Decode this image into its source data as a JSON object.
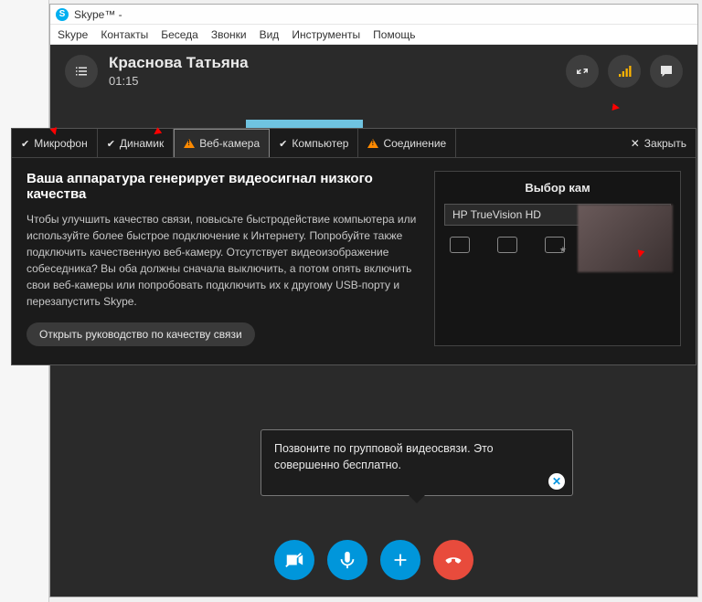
{
  "titlebar": {
    "app": "Skype™ -"
  },
  "menu": {
    "skype": "Skype",
    "contacts": "Контакты",
    "conversation": "Беседа",
    "calls": "Звонки",
    "view": "Вид",
    "tools": "Инструменты",
    "help": "Помощь"
  },
  "call": {
    "contact_name": "Краснова Татьяна",
    "duration": "01:15"
  },
  "diag": {
    "tabs": {
      "mic": "Микрофон",
      "speaker": "Динамик",
      "webcam": "Веб-камера",
      "computer": "Компьютер",
      "connection": "Соединение",
      "close": "Закрыть"
    },
    "title": "Ваша аппаратура генерирует видеосигнал низкого качества",
    "text": "Чтобы улучшить качество связи, повысьте быстродействие компьютера или используйте более быстрое подключение к Интернету. Попробуйте также подключить качественную веб-камеру. Отсутствует видеоизображение собеседника? Вы оба должны сначала выключить, а потом опять включить свои веб-камеры или попробовать подключить их к другому USB-порту и перезапустить Skype.",
    "guide_btn": "Открыть руководство по качеству связи",
    "camera": {
      "title": "Выбор кам",
      "selected": "HP TrueVision HD"
    }
  },
  "tooltip": {
    "text": "Позвоните по групповой видеосвязи. Это совершенно бесплатно."
  }
}
